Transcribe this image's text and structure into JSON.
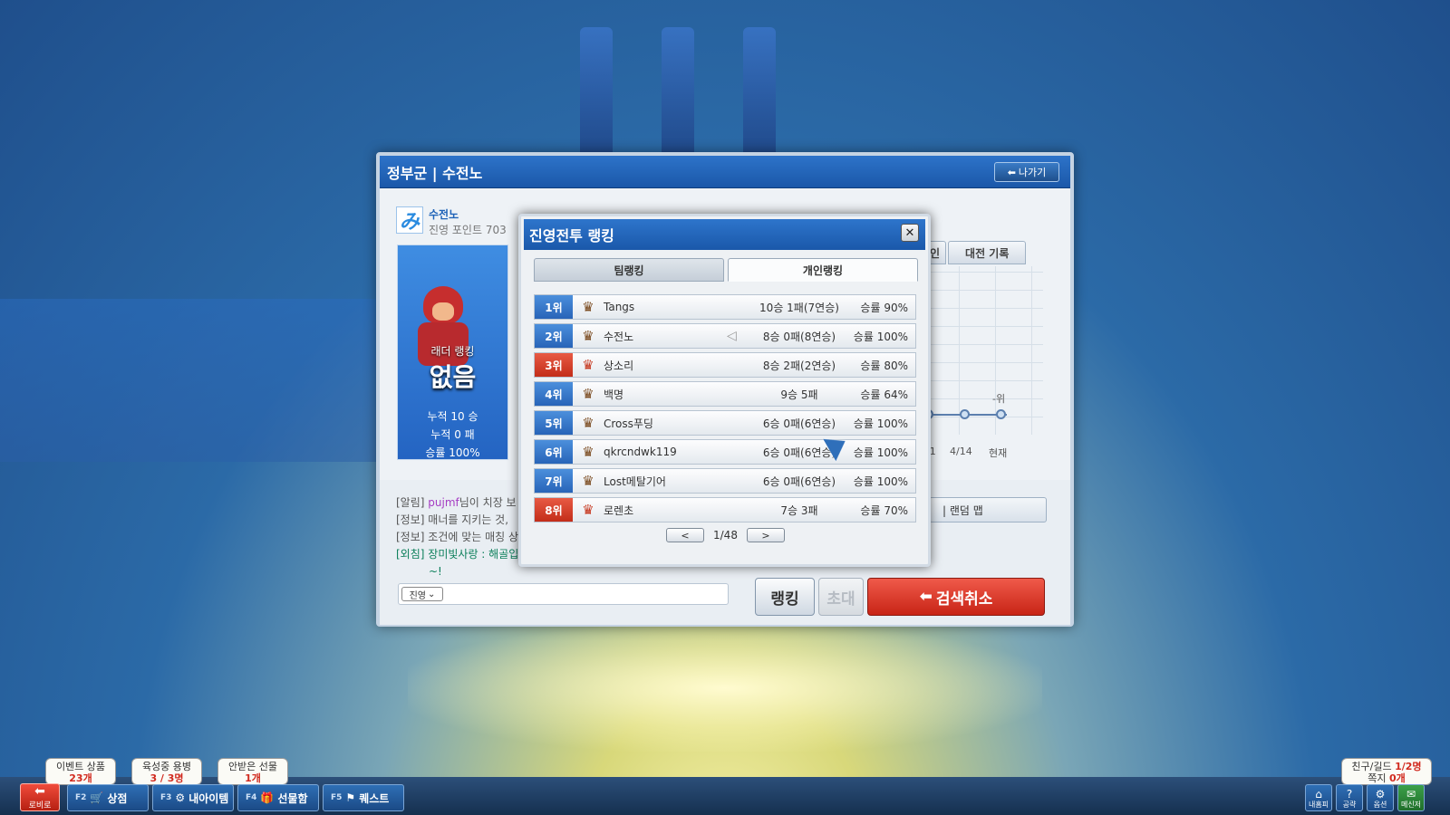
{
  "main_window": {
    "title": "정부군 | 수전노",
    "exit_label": "나가기",
    "profile": {
      "icon_glyph": "み",
      "name": "수전노",
      "points": "진영 포인트 703"
    },
    "card": {
      "ladder_label": "래더 랭킹",
      "ladder_value": "없음",
      "wins": "누적 10 승",
      "losses": "누적 0 패",
      "win_rate": "승률 100%"
    },
    "right_tabs": [
      "인",
      "대전 기록"
    ],
    "graph_labels": {
      "x1": "/31",
      "x2": "4/14",
      "x3": "현재",
      "rank": "-위"
    },
    "map_label": "| 랜덤 맵",
    "chat": [
      {
        "prefix": "[알림]",
        "user": "pujmf",
        "text": "님이 치장 보"
      },
      {
        "prefix": "[정보]",
        "text": "매너를 지키는 것,"
      },
      {
        "prefix": "[정보]",
        "text": "조건에 맞는 매칭 상"
      },
      {
        "prefix": "[외침]",
        "text": "장미빛사랑 : 해골입"
      },
      {
        "prefix": "",
        "text": "~!"
      }
    ],
    "chat_channel": "진영",
    "buttons": {
      "ranking": "랭킹",
      "invite": "초대",
      "cancel": "검색취소"
    }
  },
  "ranking_popup": {
    "title": "진영전투 랭킹",
    "close_icon": "close-icon",
    "tabs": {
      "team": "팀랭킹",
      "individual": "개인랭킹"
    },
    "rows": [
      {
        "rank": "1위",
        "name": "Tangs",
        "record": "10승 1패(7연승)",
        "rate": "승률 90%",
        "color": "blue"
      },
      {
        "rank": "2위",
        "name": "수전노",
        "record": "8승 0패(8연승)",
        "rate": "승률 100%",
        "color": "blue"
      },
      {
        "rank": "3위",
        "name": "상소리",
        "record": "8승 2패(2연승)",
        "rate": "승률 80%",
        "color": "red"
      },
      {
        "rank": "4위",
        "name": "백명",
        "record": "9승 5패",
        "rate": "승률 64%",
        "color": "blue"
      },
      {
        "rank": "5위",
        "name": "Cross푸딩",
        "record": "6승 0패(6연승)",
        "rate": "승률 100%",
        "color": "blue"
      },
      {
        "rank": "6위",
        "name": "qkrcndwk119",
        "record": "6승 0패(6연승)",
        "rate": "승률 100%",
        "color": "blue"
      },
      {
        "rank": "7위",
        "name": "Lost메탈기어",
        "record": "6승 0패(6연승)",
        "rate": "승률 100%",
        "color": "blue"
      },
      {
        "rank": "8위",
        "name": "로렌초",
        "record": "7승 3패",
        "rate": "승률 70%",
        "color": "red"
      }
    ],
    "page": "1/48"
  },
  "bottom_bar": {
    "lobby": "로비로",
    "bubbles": [
      {
        "title": "이벤트 상품",
        "value": "23개"
      },
      {
        "title": "육성중 용병",
        "value": "3 / 3명"
      },
      {
        "title": "안받은 선물",
        "value": "1개"
      }
    ],
    "buttons": [
      {
        "key": "F2",
        "label": "상점"
      },
      {
        "key": "F3",
        "label": "내아이템"
      },
      {
        "key": "F4",
        "label": "선물함"
      },
      {
        "key": "F5",
        "label": "퀘스트"
      }
    ],
    "friend": {
      "line1_label": "친구/길드",
      "line1_value": "1/2명",
      "line2_label": "쪽지",
      "line2_value": "0개"
    },
    "sys_icons": [
      "내홈피",
      "공략",
      "옵션",
      "메신저"
    ]
  }
}
